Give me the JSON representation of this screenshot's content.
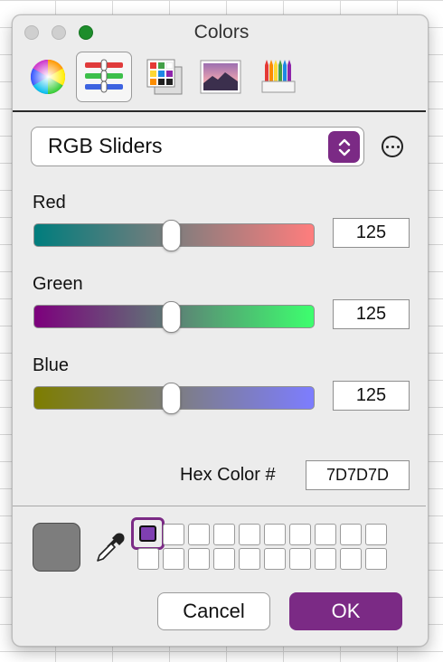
{
  "window": {
    "title": "Colors"
  },
  "toolbar": {
    "modes": [
      {
        "icon": "color-wheel-icon",
        "selected": false
      },
      {
        "icon": "color-sliders-icon",
        "selected": true
      },
      {
        "icon": "color-palettes-icon",
        "selected": false
      },
      {
        "icon": "image-palettes-icon",
        "selected": false
      },
      {
        "icon": "pencils-icon",
        "selected": false
      }
    ]
  },
  "slider_mode": {
    "selected": "RGB Sliders"
  },
  "sliders": {
    "red": {
      "label": "Red",
      "value": "125",
      "level": 0.49
    },
    "green": {
      "label": "Green",
      "value": "125",
      "level": 0.49
    },
    "blue": {
      "label": "Blue",
      "value": "125",
      "level": 0.49
    }
  },
  "hex": {
    "label": "Hex Color #",
    "value": "7D7D7D"
  },
  "current_color": "#7D7D7D",
  "swatch_grid": {
    "selected_color": "#7F3FB2",
    "columns": 10,
    "rows": 2
  },
  "buttons": {
    "cancel": "Cancel",
    "ok": "OK"
  },
  "colors": {
    "accent": "#7B2A85",
    "traffic_zoom": "#1D8D2B"
  }
}
